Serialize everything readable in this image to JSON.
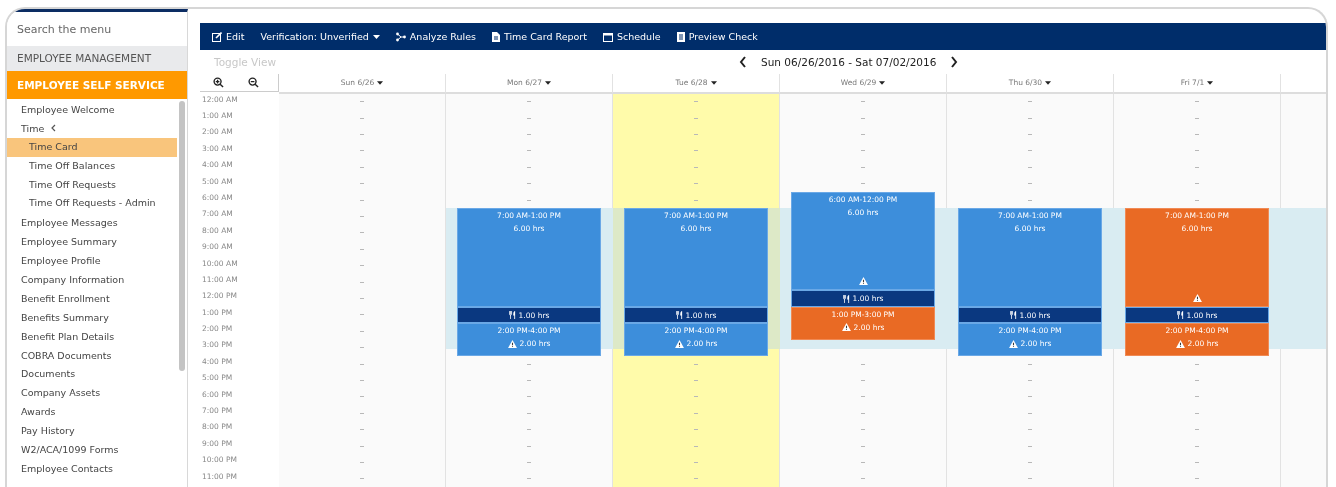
{
  "sidebar": {
    "search": {
      "placeholder": "Search the menu"
    },
    "sections": [
      {
        "label": "EMPLOYEE MANAGEMENT",
        "expanded": false
      },
      {
        "label": "EMPLOYEE SELF SERVICE",
        "expanded": true,
        "items": [
          {
            "label": "Employee Welcome",
            "selected": false
          },
          {
            "label": "Time",
            "selected": false,
            "expanded": true,
            "children": [
              {
                "label": "Time Card",
                "selected": true
              },
              {
                "label": "Time Off Balances",
                "selected": false
              },
              {
                "label": "Time Off Requests",
                "selected": false
              },
              {
                "label": "Time Off Requests - Admin",
                "selected": false
              }
            ]
          },
          {
            "label": "Employee Messages",
            "selected": false
          },
          {
            "label": "Employee Summary",
            "selected": false
          },
          {
            "label": "Employee Profile",
            "selected": false
          },
          {
            "label": "Company Information",
            "selected": false
          },
          {
            "label": "Benefit Enrollment",
            "selected": false
          },
          {
            "label": "Benefits Summary",
            "selected": false
          },
          {
            "label": "Benefit Plan Details",
            "selected": false
          },
          {
            "label": "COBRA Documents",
            "selected": false
          },
          {
            "label": "Documents",
            "selected": false
          },
          {
            "label": "Company Assets",
            "selected": false
          },
          {
            "label": "Awards",
            "selected": false
          },
          {
            "label": "Pay History",
            "selected": false
          },
          {
            "label": "W2/ACA/1099 Forms",
            "selected": false
          },
          {
            "label": "Employee Contacts",
            "selected": false
          }
        ]
      }
    ]
  },
  "toolbar": [
    {
      "label": "Edit",
      "dropdown": false
    },
    {
      "label": "Verification: Unverified",
      "dropdown": true
    },
    {
      "label": "Analyze Rules",
      "dropdown": false
    },
    {
      "label": "Time Card Report",
      "dropdown": false
    },
    {
      "label": "Schedule",
      "dropdown": false
    },
    {
      "label": "Preview Check",
      "dropdown": false
    }
  ],
  "toggle_view": "Toggle View",
  "date_range": "Sun 06/26/2016 - Sat 07/02/2016",
  "hours": [
    "12:00 AM",
    "1:00 AM",
    "2:00 AM",
    "3:00 AM",
    "4:00 AM",
    "5:00 AM",
    "6:00 AM",
    "7:00 AM",
    "8:00 AM",
    "9:00 AM",
    "10:00 AM",
    "11:00 AM",
    "12:00 PM",
    "1:00 PM",
    "2:00 PM",
    "3:00 PM",
    "4:00 PM",
    "5:00 PM",
    "6:00 PM",
    "7:00 PM",
    "8:00 PM",
    "9:00 PM",
    "10:00 PM",
    "11:00 PM"
  ],
  "days": [
    {
      "label": "Sun 6/26",
      "highlighted": false,
      "scheduled": false
    },
    {
      "label": "Mon 6/27",
      "highlighted": false,
      "scheduled": true,
      "entries": [
        {
          "kind": "shift",
          "time": "7:00 AM-1:00 PM",
          "hours": "6.00 hrs",
          "exception": false,
          "warning": false
        },
        {
          "kind": "break",
          "hours": "1.00 hrs"
        },
        {
          "kind": "shift",
          "time": "2:00 PM-4:00 PM",
          "hours": "2.00 hrs",
          "exception": false,
          "warning": true
        }
      ]
    },
    {
      "label": "Tue 6/28",
      "highlighted": true,
      "scheduled": true,
      "entries": [
        {
          "kind": "shift",
          "time": "7:00 AM-1:00 PM",
          "hours": "6.00 hrs",
          "exception": false,
          "warning": false
        },
        {
          "kind": "break",
          "hours": "1.00 hrs"
        },
        {
          "kind": "shift",
          "time": "2:00 PM-4:00 PM",
          "hours": "2.00 hrs",
          "exception": false,
          "warning": true
        }
      ]
    },
    {
      "label": "Wed 6/29",
      "highlighted": false,
      "scheduled": true,
      "entries": [
        {
          "kind": "shift",
          "time": "6:00 AM-12:00 PM",
          "hours": "6.00 hrs",
          "exception": false,
          "warning": true
        },
        {
          "kind": "break",
          "hours": "1.00 hrs"
        },
        {
          "kind": "shift",
          "time": "1:00 PM-3:00 PM",
          "hours": "2.00 hrs",
          "exception": true,
          "warning": true
        }
      ]
    },
    {
      "label": "Thu 6/30",
      "highlighted": false,
      "scheduled": true,
      "entries": [
        {
          "kind": "shift",
          "time": "7:00 AM-1:00 PM",
          "hours": "6.00 hrs",
          "exception": false,
          "warning": false
        },
        {
          "kind": "break",
          "hours": "1.00 hrs"
        },
        {
          "kind": "shift",
          "time": "2:00 PM-4:00 PM",
          "hours": "2.00 hrs",
          "exception": false,
          "warning": true
        }
      ]
    },
    {
      "label": "Fri 7/1",
      "highlighted": false,
      "scheduled": true,
      "entries": [
        {
          "kind": "shift",
          "time": "7:00 AM-1:00 PM",
          "hours": "6.00 hrs",
          "exception": true,
          "warning": true
        },
        {
          "kind": "break",
          "hours": "1.00 hrs"
        },
        {
          "kind": "shift",
          "time": "2:00 PM-4:00 PM",
          "hours": "2.00 hrs",
          "exception": true,
          "warning": true
        }
      ]
    }
  ]
}
